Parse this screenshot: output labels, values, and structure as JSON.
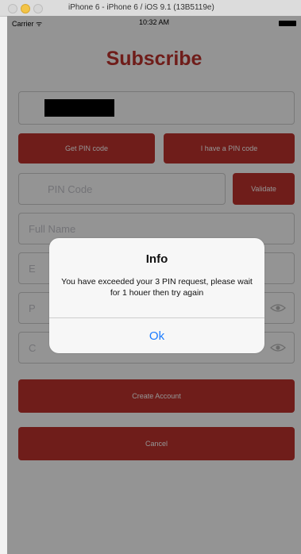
{
  "simulator": {
    "window_title": "iPhone 6 - iPhone 6 / iOS 9.1 (13B5119e)"
  },
  "status_bar": {
    "carrier": "Carrier ᯤ",
    "time": "10:32 AM"
  },
  "form": {
    "title": "Subscribe",
    "get_pin_label": "Get PIN code",
    "have_pin_label": "I have a PIN code",
    "pin_placeholder": "PIN Code",
    "validate_label": "Validate",
    "full_name_placeholder": "Full Name",
    "email_placeholder": "E",
    "password_placeholder": "P",
    "confirm_placeholder": "C",
    "create_account_label": "Create Account",
    "cancel_label": "Cancel"
  },
  "alert": {
    "title": "Info",
    "message": "You have exceeded your 3 PIN request, please wait for 1 houer then try again",
    "ok_label": "Ok"
  },
  "colors": {
    "accent": "#c0332d",
    "link": "#1a7bff"
  }
}
